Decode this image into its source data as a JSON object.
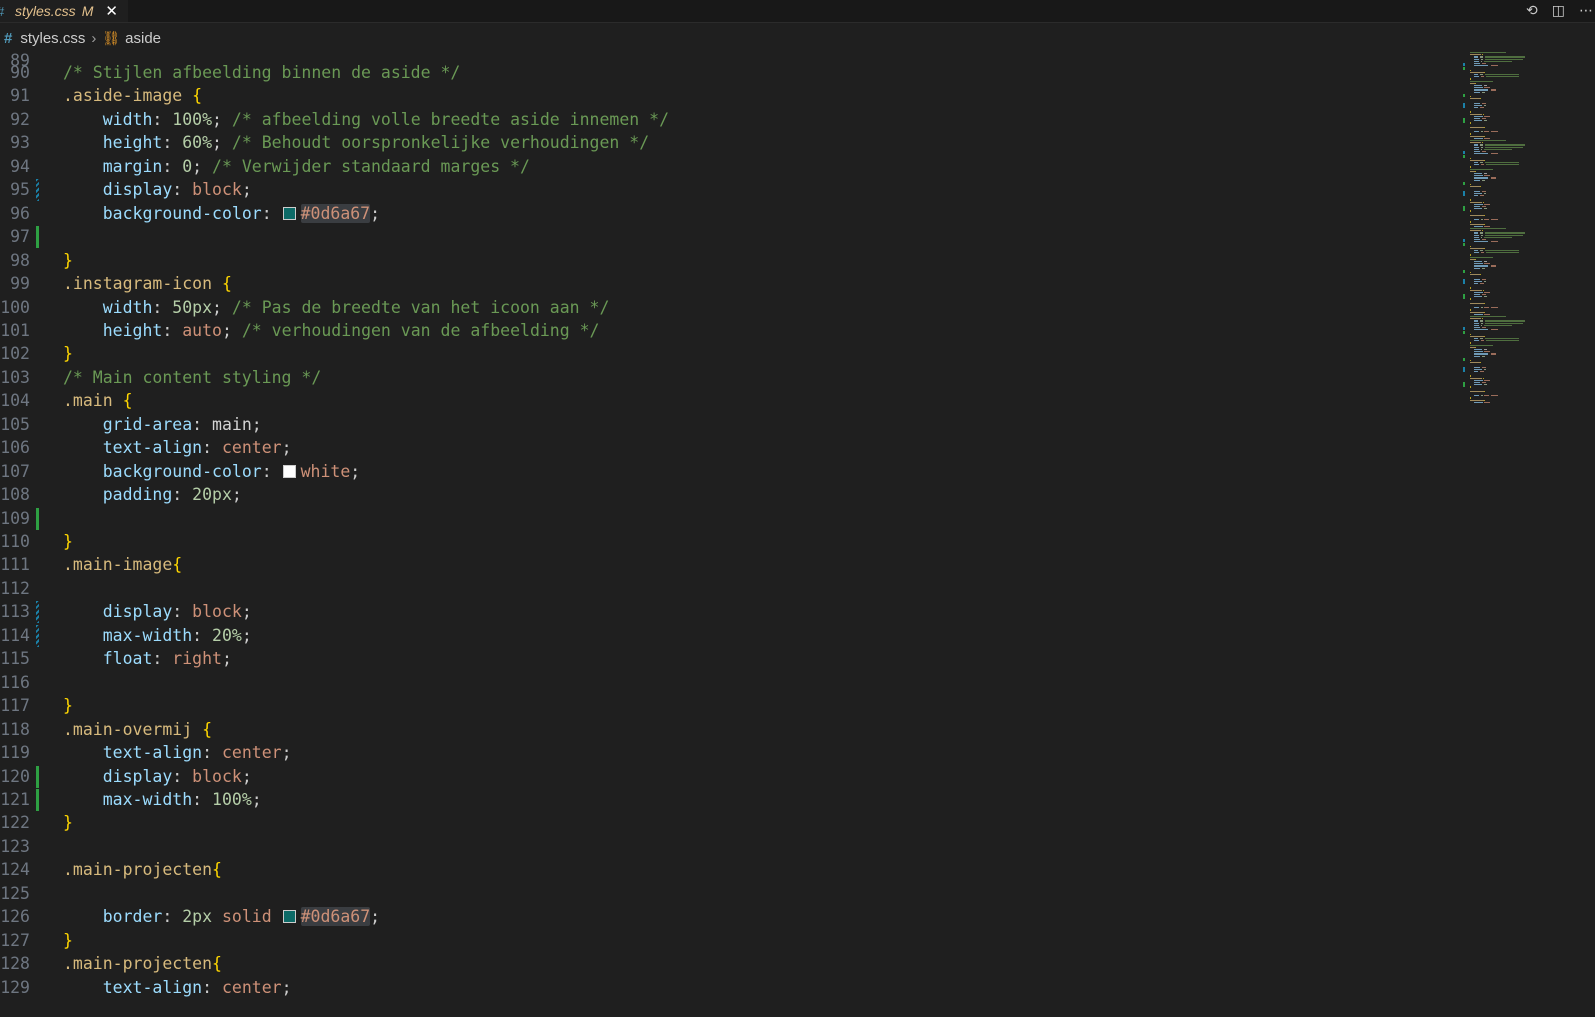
{
  "tab": {
    "icon": "css-hash-icon",
    "filename": "styles.css",
    "status": "M",
    "close": "✕"
  },
  "top_actions": {
    "compare_icon": "⟲",
    "split_icon": "◫",
    "more_icon": "⋯"
  },
  "breadcrumb": {
    "icon": "#",
    "file": "styles.css",
    "separator": "›",
    "symbol_icon": "⛓",
    "symbol": "aside"
  },
  "colors": {
    "swatch_teal": "#0d6a67",
    "swatch_white": "#ffffff"
  },
  "partial_top_line": "89",
  "lines": [
    {
      "n": "90",
      "gutter": "",
      "tokens": [
        [
          "c",
          "/* Stijlen afbeelding binnen de aside */"
        ]
      ]
    },
    {
      "n": "91",
      "gutter": "",
      "tokens": [
        [
          "s",
          ".aside-image"
        ],
        [
          "p",
          " "
        ],
        [
          "b",
          "{"
        ]
      ]
    },
    {
      "n": "92",
      "gutter": "",
      "tokens": [
        [
          "p",
          "    "
        ],
        [
          "k",
          "width"
        ],
        [
          "p",
          ": "
        ],
        [
          "n",
          "100%"
        ],
        [
          "p",
          "; "
        ],
        [
          "c",
          "/* afbeelding volle breedte aside innemen */"
        ]
      ]
    },
    {
      "n": "93",
      "gutter": "",
      "tokens": [
        [
          "p",
          "    "
        ],
        [
          "k",
          "height"
        ],
        [
          "p",
          ": "
        ],
        [
          "n",
          "60%"
        ],
        [
          "p",
          "; "
        ],
        [
          "c",
          "/* Behoudt oorspronkelijke verhoudingen */"
        ]
      ]
    },
    {
      "n": "94",
      "gutter": "",
      "tokens": [
        [
          "p",
          "    "
        ],
        [
          "k",
          "margin"
        ],
        [
          "p",
          ": "
        ],
        [
          "n",
          "0"
        ],
        [
          "p",
          "; "
        ],
        [
          "c",
          "/* Verwijder standaard marges */"
        ]
      ]
    },
    {
      "n": "95",
      "gutter": "modified",
      "tokens": [
        [
          "p",
          "    "
        ],
        [
          "k",
          "display"
        ],
        [
          "p",
          ": "
        ],
        [
          "v",
          "block"
        ],
        [
          "p",
          ";"
        ]
      ]
    },
    {
      "n": "96",
      "gutter": "",
      "tokens": [
        [
          "p",
          "    "
        ],
        [
          "k",
          "background-color"
        ],
        [
          "p",
          ": "
        ],
        [
          "sw",
          "teal"
        ],
        [
          "h",
          "#0d6a67"
        ],
        [
          "p",
          ";"
        ]
      ]
    },
    {
      "n": "97",
      "gutter": "added",
      "tokens": []
    },
    {
      "n": "98",
      "gutter": "",
      "tokens": [
        [
          "b",
          "}"
        ]
      ]
    },
    {
      "n": "99",
      "gutter": "",
      "tokens": [
        [
          "s",
          ".instagram-icon"
        ],
        [
          "p",
          " "
        ],
        [
          "b",
          "{"
        ]
      ]
    },
    {
      "n": "100",
      "gutter": "",
      "tokens": [
        [
          "p",
          "    "
        ],
        [
          "k",
          "width"
        ],
        [
          "p",
          ": "
        ],
        [
          "n",
          "50px"
        ],
        [
          "p",
          "; "
        ],
        [
          "c",
          "/* Pas de breedte van het icoon aan */"
        ]
      ]
    },
    {
      "n": "101",
      "gutter": "",
      "tokens": [
        [
          "p",
          "    "
        ],
        [
          "k",
          "height"
        ],
        [
          "p",
          ": "
        ],
        [
          "v",
          "auto"
        ],
        [
          "p",
          "; "
        ],
        [
          "c",
          "/* verhoudingen van de afbeelding */"
        ]
      ]
    },
    {
      "n": "102",
      "gutter": "",
      "tokens": [
        [
          "b",
          "}"
        ]
      ]
    },
    {
      "n": "103",
      "gutter": "",
      "tokens": [
        [
          "c",
          "/* Main content styling */"
        ]
      ]
    },
    {
      "n": "104",
      "gutter": "",
      "tokens": [
        [
          "s",
          ".main"
        ],
        [
          "p",
          " "
        ],
        [
          "b",
          "{"
        ]
      ]
    },
    {
      "n": "105",
      "gutter": "",
      "tokens": [
        [
          "p",
          "    "
        ],
        [
          "k",
          "grid-area"
        ],
        [
          "p",
          ": "
        ],
        [
          "t",
          "main"
        ],
        [
          "p",
          ";"
        ]
      ]
    },
    {
      "n": "106",
      "gutter": "",
      "tokens": [
        [
          "p",
          "    "
        ],
        [
          "k",
          "text-align"
        ],
        [
          "p",
          ": "
        ],
        [
          "v",
          "center"
        ],
        [
          "p",
          ";"
        ]
      ]
    },
    {
      "n": "107",
      "gutter": "",
      "tokens": [
        [
          "p",
          "    "
        ],
        [
          "k",
          "background-color"
        ],
        [
          "p",
          ": "
        ],
        [
          "sw",
          "white"
        ],
        [
          "v",
          "white"
        ],
        [
          "p",
          ";"
        ]
      ]
    },
    {
      "n": "108",
      "gutter": "",
      "tokens": [
        [
          "p",
          "    "
        ],
        [
          "k",
          "padding"
        ],
        [
          "p",
          ": "
        ],
        [
          "n",
          "20px"
        ],
        [
          "p",
          ";"
        ]
      ]
    },
    {
      "n": "109",
      "gutter": "added",
      "tokens": []
    },
    {
      "n": "110",
      "gutter": "",
      "tokens": [
        [
          "b",
          "}"
        ]
      ]
    },
    {
      "n": "111",
      "gutter": "",
      "tokens": [
        [
          "s",
          ".main-image"
        ],
        [
          "b",
          "{"
        ]
      ]
    },
    {
      "n": "112",
      "gutter": "",
      "tokens": []
    },
    {
      "n": "113",
      "gutter": "modified",
      "tokens": [
        [
          "p",
          "    "
        ],
        [
          "k",
          "display"
        ],
        [
          "p",
          ": "
        ],
        [
          "v",
          "block"
        ],
        [
          "p",
          ";"
        ]
      ]
    },
    {
      "n": "114",
      "gutter": "modified",
      "tokens": [
        [
          "p",
          "    "
        ],
        [
          "k",
          "max-width"
        ],
        [
          "p",
          ": "
        ],
        [
          "n",
          "20%"
        ],
        [
          "p",
          ";"
        ]
      ]
    },
    {
      "n": "115",
      "gutter": "",
      "tokens": [
        [
          "p",
          "    "
        ],
        [
          "k",
          "float"
        ],
        [
          "p",
          ": "
        ],
        [
          "v",
          "right"
        ],
        [
          "p",
          ";"
        ]
      ]
    },
    {
      "n": "116",
      "gutter": "",
      "tokens": []
    },
    {
      "n": "117",
      "gutter": "",
      "tokens": [
        [
          "b",
          "}"
        ]
      ]
    },
    {
      "n": "118",
      "gutter": "",
      "tokens": [
        [
          "s",
          ".main-overmij"
        ],
        [
          "p",
          " "
        ],
        [
          "b",
          "{"
        ]
      ]
    },
    {
      "n": "119",
      "gutter": "",
      "tokens": [
        [
          "p",
          "    "
        ],
        [
          "k",
          "text-align"
        ],
        [
          "p",
          ": "
        ],
        [
          "v",
          "center"
        ],
        [
          "p",
          ";"
        ]
      ]
    },
    {
      "n": "120",
      "gutter": "added",
      "tokens": [
        [
          "p",
          "    "
        ],
        [
          "k",
          "display"
        ],
        [
          "p",
          ": "
        ],
        [
          "v",
          "block"
        ],
        [
          "p",
          ";"
        ]
      ]
    },
    {
      "n": "121",
      "gutter": "added",
      "tokens": [
        [
          "p",
          "    "
        ],
        [
          "k",
          "max-width"
        ],
        [
          "p",
          ": "
        ],
        [
          "n",
          "100%"
        ],
        [
          "p",
          ";"
        ]
      ]
    },
    {
      "n": "122",
      "gutter": "",
      "tokens": [
        [
          "b",
          "}"
        ]
      ]
    },
    {
      "n": "123",
      "gutter": "",
      "tokens": []
    },
    {
      "n": "124",
      "gutter": "",
      "tokens": [
        [
          "s",
          ".main-projecten"
        ],
        [
          "b",
          "{"
        ]
      ]
    },
    {
      "n": "125",
      "gutter": "",
      "tokens": []
    },
    {
      "n": "126",
      "gutter": "",
      "tokens": [
        [
          "p",
          "    "
        ],
        [
          "k",
          "border"
        ],
        [
          "p",
          ": "
        ],
        [
          "n",
          "2px"
        ],
        [
          "p",
          " "
        ],
        [
          "v",
          "solid"
        ],
        [
          "p",
          " "
        ],
        [
          "sw",
          "teal"
        ],
        [
          "h",
          "#0d6a67"
        ],
        [
          "p",
          ";"
        ]
      ]
    },
    {
      "n": "127",
      "gutter": "",
      "tokens": [
        [
          "b",
          "}"
        ]
      ]
    },
    {
      "n": "128",
      "gutter": "",
      "tokens": [
        [
          "s",
          ".main-projecten"
        ],
        [
          "b",
          "{"
        ]
      ]
    },
    {
      "n": "129",
      "gutter": "",
      "tokens": [
        [
          "p",
          "    "
        ],
        [
          "k",
          "text-align"
        ],
        [
          "p",
          ": "
        ],
        [
          "v",
          "center"
        ],
        [
          "p",
          ";"
        ]
      ]
    }
  ]
}
